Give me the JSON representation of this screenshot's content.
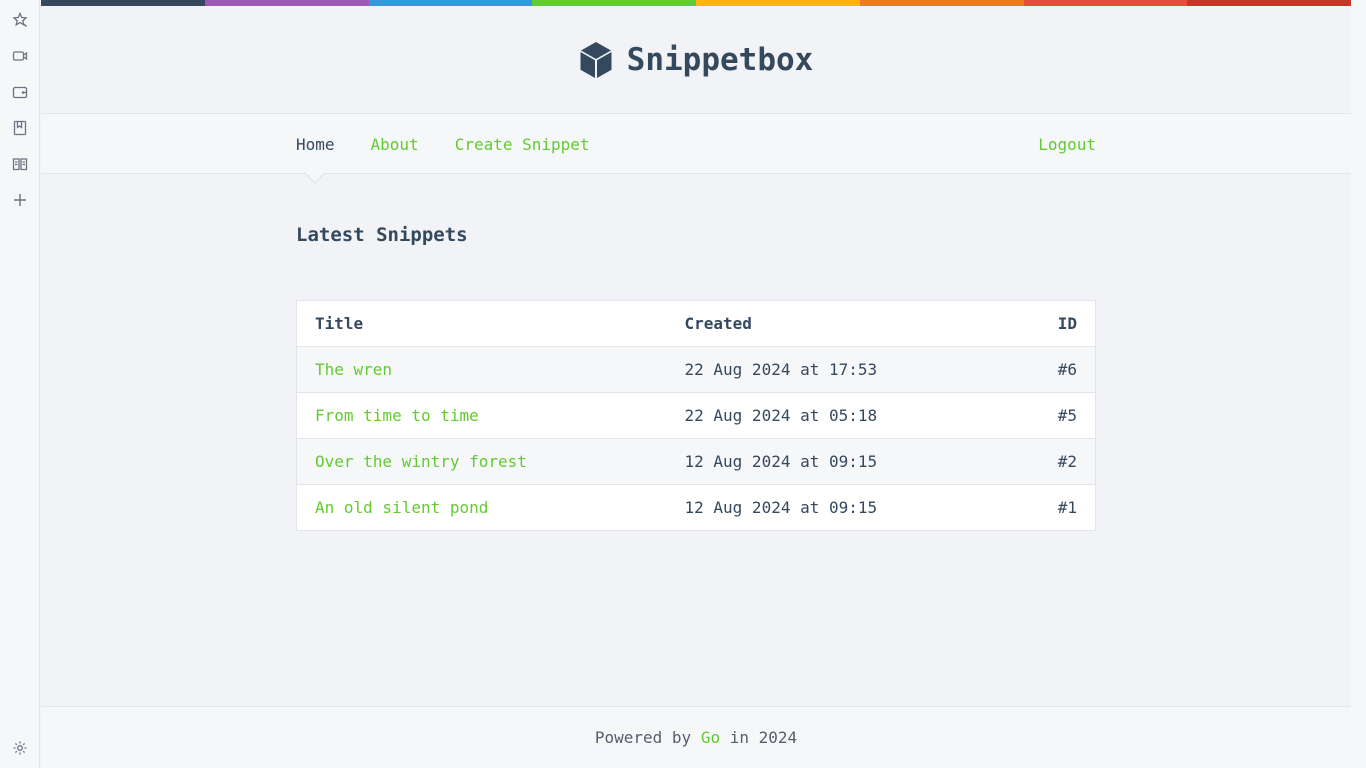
{
  "sidebar": {
    "icons": [
      "star-icon",
      "video-icon",
      "wallet-icon",
      "bookmark-icon",
      "reading-list-icon",
      "plus-icon"
    ],
    "settings_icon": "gear-icon"
  },
  "stripe_colors": [
    "#34495e",
    "#9b59b6",
    "#3498db",
    "#62cb31",
    "#ffb606",
    "#e67e22",
    "#e74c3c",
    "#c0392b"
  ],
  "brand": {
    "title": "Snippetbox",
    "logo_icon": "cube-icon",
    "color": "#34495e"
  },
  "nav": {
    "home": "Home",
    "about": "About",
    "create": "Create Snippet",
    "logout": "Logout",
    "active": "Home"
  },
  "main": {
    "heading": "Latest Snippets",
    "table": {
      "headers": {
        "title": "Title",
        "created": "Created",
        "id": "ID"
      },
      "rows": [
        {
          "title": "The wren",
          "created": "22 Aug 2024 at 17:53",
          "id": "#6"
        },
        {
          "title": "From time to time",
          "created": "22 Aug 2024 at 05:18",
          "id": "#5"
        },
        {
          "title": "Over the wintry forest",
          "created": "12 Aug 2024 at 09:15",
          "id": "#2"
        },
        {
          "title": "An old silent pond",
          "created": "12 Aug 2024 at 09:15",
          "id": "#1"
        }
      ]
    }
  },
  "footer": {
    "prefix": "Powered by",
    "link": "Go",
    "suffix": "in 2024"
  },
  "colors": {
    "accent": "#62cb31",
    "text": "#34495e",
    "background": "#f1f3f6"
  }
}
